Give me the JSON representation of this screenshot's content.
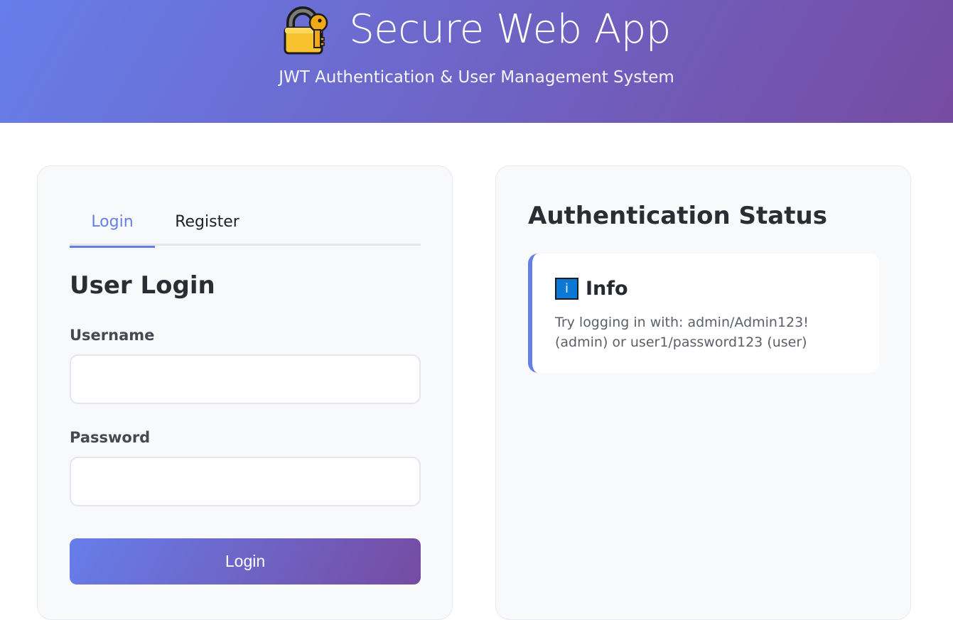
{
  "header": {
    "title": "Secure Web App",
    "subtitle": "JWT Authentication & User Management System",
    "icon": "lock-key-icon"
  },
  "auth_panel": {
    "tabs": [
      {
        "label": "Login",
        "active": true
      },
      {
        "label": "Register",
        "active": false
      }
    ],
    "heading": "User Login",
    "username_label": "Username",
    "username_value": "",
    "password_label": "Password",
    "password_value": "",
    "submit_label": "Login"
  },
  "status_panel": {
    "heading": "Authentication Status",
    "info": {
      "icon": "info-icon",
      "icon_glyph": "i",
      "title": "Info",
      "message": "Try logging in with: admin/Admin123! (admin) or user1/password123 (user)"
    }
  },
  "colors": {
    "gradient_start": "#667eea",
    "gradient_end": "#764ba2",
    "accent": "#667eea"
  }
}
